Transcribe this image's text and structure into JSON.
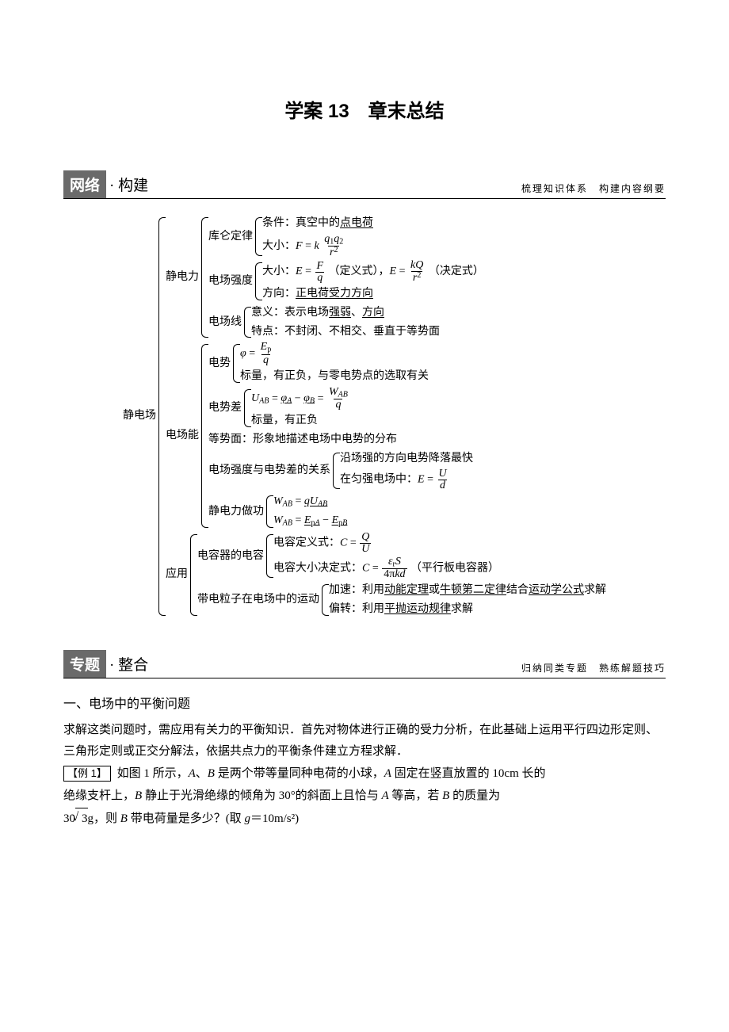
{
  "title": "学案 13 章末总结",
  "section1": {
    "box": "网络",
    "sub": "· 构建",
    "right": "梳理知识体系 构建内容纲要"
  },
  "section2": {
    "box": "专题",
    "sub": "· 整合",
    "right": "归纳同类专题 熟练解题技巧"
  },
  "diagram": {
    "root": "静电场",
    "a_label": "静电力",
    "a1_label": "库仑定律",
    "a1_lines": {
      "cond": "条件：真空中的",
      "cond_u": "点电荷",
      "size_prefix": "大小："
    },
    "a2_label": "电场强度",
    "a2_lines": {
      "size_prefix": "大小：",
      "def_txt": "（定义式），",
      "det_txt": "（决定式）",
      "dir_prefix": "方向：",
      "dir_u": "正电荷受力方向"
    },
    "a3_label": "电场线",
    "a3_lines": {
      "mean": "意义：表示电场",
      "mean_u1": "强弱",
      "mean_sep": "、",
      "mean_u2": "方向",
      "feat": "特点：不封闭、不相交、垂直于等势面"
    },
    "b_label": "电场能",
    "b1_label": "电势",
    "b1_lines": {
      "scalar": "标量，有正负，与零电势点的选取有关"
    },
    "b2_label": "电势差",
    "b2_lines": {
      "scalar": "标量，有正负"
    },
    "b3": "等势面：形象地描述电场中电势的分布",
    "b4_label": "电场强度与电势差的关系",
    "b4_lines": {
      "l1": "沿场强的方向电势降落最快",
      "l2pre": "在匀强电场中："
    },
    "b5_label": "静电力做功",
    "c_label": "应用",
    "c1_label": "电容器的电容",
    "c1_lines": {
      "def_pre": "电容定义式：",
      "det_pre": "电容大小决定式：",
      "det_suf": "（平行板电容器）"
    },
    "c2_label": "带电粒子在电场中的运动",
    "c2_lines": {
      "acc_pre": "加速：利用",
      "acc_u1": "动能定理",
      "acc_mid": "或",
      "acc_u2": "牛顿第二定律",
      "acc_mid2": "结合",
      "acc_u3": "运动学公式",
      "acc_suf": "求解",
      "def_pre": "偏转：利用",
      "def_u": "平抛运动规律",
      "def_suf": "求解"
    }
  },
  "topic1": {
    "heading": "一、电场中的平衡问题",
    "p1": "求解这类问题时，需应用有关力的平衡知识．首先对物体进行正确的受力分析，在此基础上运用平行四边形定则、三角形定则或正交分解法，依据共点力的平衡条件建立方程求解．",
    "ex_label": "【例 1】",
    "ex_pre": "如图 1 所示，",
    "ex_a": "A",
    "ex_sep1": "、",
    "ex_b": "B",
    "ex_t1": " 是两个带等量同种电荷的小球，",
    "ex_t2": " 固定在竖直放置的 10cm 长的",
    "ex_t3": "绝缘支杆上，",
    "ex_t4": " 静止于光滑绝缘的倾角为 30°的斜面上且恰与 ",
    "ex_t5": " 等高，若 ",
    "ex_t6": " 的质量为",
    "ex_mass_num": "30",
    "ex_mass_root": "3",
    "ex_mass_unit": "g，则 ",
    "ex_q": " 带电荷量是多少？(取 ",
    "ex_g": "g",
    "ex_geq": "＝10m/s²)"
  }
}
